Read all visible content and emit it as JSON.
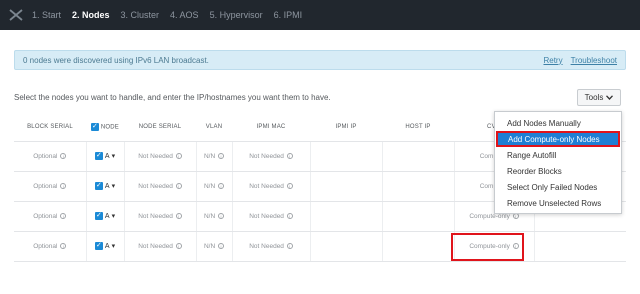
{
  "steps": [
    {
      "label": "1. Start",
      "active": false
    },
    {
      "label": "2. Nodes",
      "active": true
    },
    {
      "label": "3. Cluster",
      "active": false
    },
    {
      "label": "4. AOS",
      "active": false
    },
    {
      "label": "5. Hypervisor",
      "active": false
    },
    {
      "label": "6. IPMI",
      "active": false
    }
  ],
  "banner": {
    "message": "0 nodes were discovered using IPv6 LAN broadcast.",
    "retry": "Retry",
    "troubleshoot": "Troubleshoot"
  },
  "instructions": "Select the nodes you want to handle, and enter the IP/hostnames you want them to have.",
  "tools_button": "Tools",
  "columns": [
    "BLOCK SERIAL",
    "NODE",
    "NODE SERIAL",
    "VLAN",
    "IPMI MAC",
    "IPMI IP",
    "HOST IP",
    "CVM"
  ],
  "rows": [
    {
      "block_serial": "Optional",
      "node": "A",
      "node_serial": "Not Needed",
      "vlan": "N/N",
      "ipmi_mac": "Not Needed",
      "cvm": "Compute-"
    },
    {
      "block_serial": "Optional",
      "node": "A",
      "node_serial": "Not Needed",
      "vlan": "N/N",
      "ipmi_mac": "Not Needed",
      "cvm": "Compute-"
    },
    {
      "block_serial": "Optional",
      "node": "A",
      "node_serial": "Not Needed",
      "vlan": "N/N",
      "ipmi_mac": "Not Needed",
      "cvm": "Compute-only"
    },
    {
      "block_serial": "Optional",
      "node": "A",
      "node_serial": "Not Needed",
      "vlan": "N/N",
      "ipmi_mac": "Not Needed",
      "cvm": "Compute-only"
    }
  ],
  "tools_menu": [
    "Add Nodes Manually",
    "Add Compute-only Nodes",
    "Range Autofill",
    "Reorder Blocks",
    "Select Only Failed Nodes",
    "Remove Unselected Rows"
  ],
  "colors": {
    "accent": "#1f7fd4",
    "highlight_border": "#e0141b",
    "topbar": "#21272e"
  }
}
